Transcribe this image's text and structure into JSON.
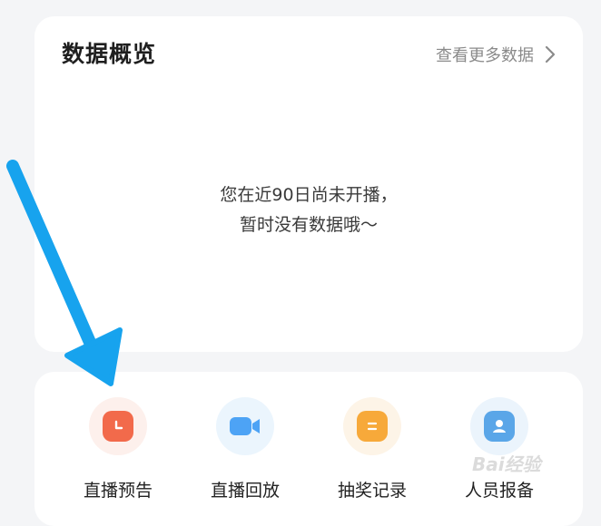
{
  "overview": {
    "title": "数据概览",
    "more_link": "查看更多数据",
    "empty_line_1": "您在近90日尚未开播，",
    "empty_line_2": "暂时没有数据哦～"
  },
  "tools": [
    {
      "label": "直播预告",
      "icon": "clock-icon",
      "color": "#f26a4b",
      "bg": "#fdf0ec"
    },
    {
      "label": "直播回放",
      "icon": "video-camera-icon",
      "color": "#4da3f5",
      "bg": "#ebf5fd"
    },
    {
      "label": "抽奖记录",
      "icon": "gift-list-icon",
      "color": "#f7a93a",
      "bg": "#fdf4e7"
    },
    {
      "label": "人员报备",
      "icon": "person-card-icon",
      "color": "#5aa6e8",
      "bg": "#ebf4fc"
    }
  ],
  "annotation": {
    "arrow_color": "#17a3ee"
  },
  "watermark": "Bai经验"
}
